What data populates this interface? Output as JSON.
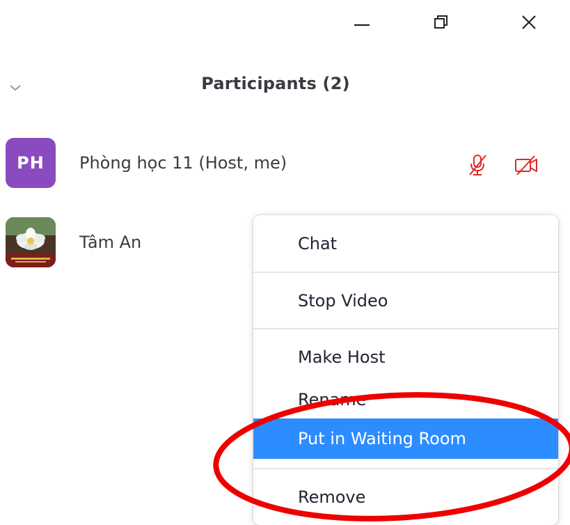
{
  "window_controls": {
    "minimize_icon": "minimize-icon",
    "restore_icon": "restore-icon",
    "close_icon": "close-icon"
  },
  "panel": {
    "title": "Participants (2)",
    "collapse_icon": "chevron-down-icon"
  },
  "participants": [
    {
      "name": "Phòng học 11 (Host, me)",
      "avatar_initials": "PH",
      "avatar_color": "#8a4bbf",
      "mic": "muted",
      "video": "off",
      "status_color": "#e02828"
    },
    {
      "name": "Tâm An",
      "avatar": "flower-photo"
    }
  ],
  "context_menu": {
    "items": [
      {
        "label": "Chat"
      },
      {
        "label": "Stop Video"
      },
      {
        "label": "Make Host"
      },
      {
        "label": "Rename"
      },
      {
        "label": "Put in Waiting Room",
        "selected": true
      },
      {
        "label": "Remove"
      }
    ],
    "highlight_color": "#2d8cff"
  },
  "annotation": {
    "shape": "ellipse",
    "color": "#ee0000",
    "target": "Put in Waiting Room"
  }
}
